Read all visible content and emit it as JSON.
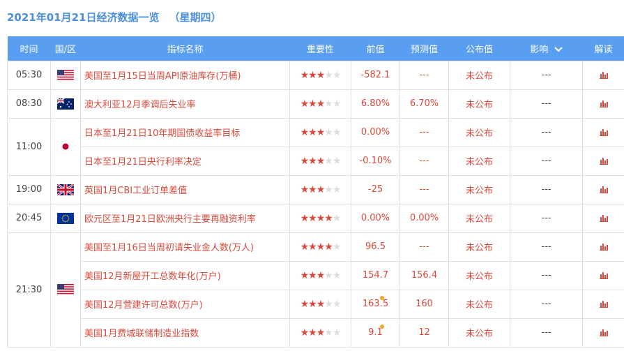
{
  "header": {
    "title": "2021年01月21日经济数据一览",
    "weekday": "（星期四）"
  },
  "columns": {
    "time": "时间",
    "country": "国/区",
    "indicator": "指标名称",
    "importance": "重要性",
    "previous": "前值",
    "forecast": "预测值",
    "actual": "公布值",
    "impact": "影响",
    "analysis": "解读"
  },
  "colors": {
    "header_bg": "#5a9ef2",
    "accent_red": "#d9493b",
    "title_blue": "#4a8fe0",
    "dot_orange": "#f5a623"
  },
  "groups": [
    {
      "time": "05:30",
      "flag": "us-flag-icon",
      "rows": [
        {
          "indicator": "美国至1月15日当周API原油库存(万桶)",
          "stars": 3,
          "previous": "-582.1",
          "forecast": "---",
          "actual": "未公布",
          "impact": "---",
          "dot": false
        }
      ]
    },
    {
      "time": "08:30",
      "flag": "australia-flag-icon",
      "rows": [
        {
          "indicator": "澳大利亚12月季调后失业率",
          "stars": 3,
          "previous": "6.80%",
          "forecast": "6.70%",
          "actual": "未公布",
          "impact": "---",
          "dot": false
        }
      ]
    },
    {
      "time": "11:00",
      "flag": "japan-flag-icon",
      "rows": [
        {
          "indicator": "日本至1月21日10年期国债收益率目标",
          "stars": 3,
          "previous": "0.00%",
          "forecast": "---",
          "actual": "未公布",
          "impact": "---",
          "dot": false
        },
        {
          "indicator": "日本至1月21日央行利率决定",
          "stars": 3,
          "previous": "-0.10%",
          "forecast": "---",
          "actual": "未公布",
          "impact": "---",
          "dot": false
        }
      ]
    },
    {
      "time": "19:00",
      "flag": "uk-flag-icon",
      "rows": [
        {
          "indicator": "英国1月CBI工业订单差值",
          "stars": 3,
          "previous": "-25",
          "forecast": "---",
          "actual": "未公布",
          "impact": "---",
          "dot": false
        }
      ]
    },
    {
      "time": "20:45",
      "flag": "eu-flag-icon",
      "rows": [
        {
          "indicator": "欧元区至1月21日欧洲央行主要再融资利率",
          "stars": 4,
          "previous": "0.00%",
          "forecast": "0.00%",
          "actual": "未公布",
          "impact": "---",
          "dot": false
        }
      ]
    },
    {
      "time": "21:30",
      "flag": "us-flag-icon",
      "rows": [
        {
          "indicator": "美国至1月16日当周初请失业金人数(万人)",
          "stars": 4,
          "previous": "96.5",
          "forecast": "---",
          "actual": "未公布",
          "impact": "---",
          "dot": false
        },
        {
          "indicator": "美国12月新屋开工总数年化(万户)",
          "stars": 3,
          "previous": "154.7",
          "forecast": "156.4",
          "actual": "未公布",
          "impact": "---",
          "dot": false
        },
        {
          "indicator": "美国12月营建许可总数(万户)",
          "stars": 3,
          "previous": "163.5",
          "forecast": "160",
          "actual": "未公布",
          "impact": "---",
          "dot": true
        },
        {
          "indicator": "美国1月费城联储制造业指数",
          "stars": 3,
          "previous": "9.1",
          "forecast": "12",
          "actual": "未公布",
          "impact": "---",
          "dot": true
        }
      ]
    }
  ]
}
